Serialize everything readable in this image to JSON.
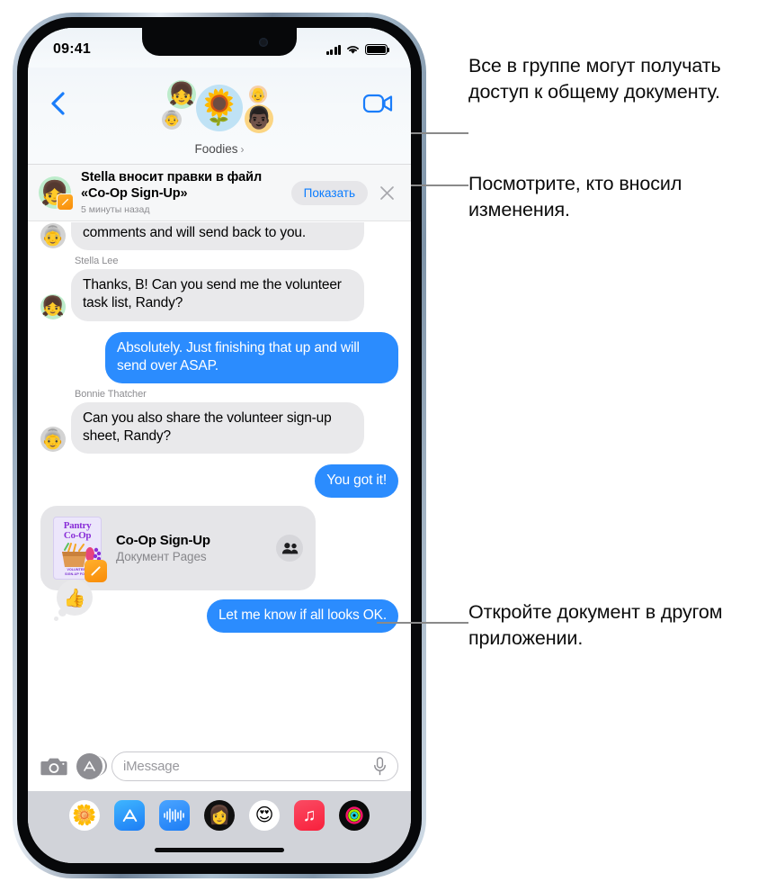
{
  "status_bar": {
    "time": "09:41",
    "signal_icon": "cellular-bars-icon",
    "wifi_icon": "wifi-icon",
    "battery_icon": "battery-icon"
  },
  "nav": {
    "back_icon": "chevron-left-icon",
    "video_icon": "facetime-video-icon",
    "group_name": "Foodies",
    "group_chevron": "›",
    "avatars": [
      {
        "name": "avatar-main-sunflower",
        "glyph": "🌻",
        "bg": "#bfe2f5"
      },
      {
        "name": "avatar-top-left-memoji",
        "glyph": "👧",
        "bg": "#bdeccb"
      },
      {
        "name": "avatar-bottom-left-memoji",
        "glyph": "👵",
        "bg": "#d3d3d3"
      },
      {
        "name": "avatar-top-right-memoji",
        "glyph": "👴",
        "bg": "#f6cfa8"
      },
      {
        "name": "avatar-bottom-right-memoji",
        "glyph": "👨🏿",
        "bg": "#fbd583"
      }
    ]
  },
  "collab_banner": {
    "avatar_glyph": "👧",
    "badge_icon": "pages-app-icon",
    "title": "Stella вносит правки в файл «Co-Op Sign-Up»",
    "subtitle": "5 минуты назад",
    "show_label": "Показать",
    "close_icon": "close-x-icon"
  },
  "messages": [
    {
      "id": "msg-bonnie-handbook",
      "direction": "in",
      "sender": "",
      "text": "Orientation Handbook, Meena! Adding comments and will send back to you.",
      "avatar_glyph": "👵",
      "avatar_bg": "#d3d3d3",
      "clipped": true
    },
    {
      "id": "msg-stella-tasklist",
      "direction": "in",
      "sender": "Stella Lee",
      "text": "Thanks, B! Can you send me the volunteer task list, Randy?",
      "avatar_glyph": "👧",
      "avatar_bg": "#bdeccb",
      "clipped": false
    },
    {
      "id": "msg-me-absolutely",
      "direction": "out",
      "sender": "",
      "text": "Absolutely. Just finishing that up and will send over ASAP.",
      "avatar_glyph": "",
      "avatar_bg": "",
      "clipped": false
    },
    {
      "id": "msg-bonnie-signup",
      "direction": "in",
      "sender": "Bonnie Thatcher",
      "text": "Can you also share the volunteer sign-up sheet, Randy?",
      "avatar_glyph": "👵",
      "avatar_bg": "#d3d3d3",
      "clipped": false
    },
    {
      "id": "msg-me-yougotit",
      "direction": "out",
      "sender": "",
      "text": "You got it!",
      "avatar_glyph": "",
      "avatar_bg": "",
      "clipped": false
    }
  ],
  "document_card": {
    "thumb_title_line1": "Pantry",
    "thumb_title_line2": "Co-Op",
    "thumb_footer_line1": "VOLUNTEER",
    "thumb_footer_line2": "SIGN-UP FORM",
    "badge_icon": "pages-app-icon",
    "name": "Co-Op Sign-Up",
    "kind": "Документ Pages",
    "collaborators_icon": "two-people-icon"
  },
  "last_message": {
    "id": "msg-me-looksok",
    "text": "Let me know if all looks OK.",
    "reaction_glyph": "👍",
    "reaction_name": "thumbs-up-reaction"
  },
  "input_bar": {
    "camera_icon": "camera-icon",
    "appstore_icon": "app-store-icon",
    "placeholder": "iMessage",
    "mic_icon": "microphone-icon"
  },
  "app_dock": [
    {
      "name": "dock-app-photos",
      "glyph": "🌼",
      "bg": "#ffffff"
    },
    {
      "name": "dock-app-store",
      "glyph": "🅰",
      "bg": "#1f9bff"
    },
    {
      "name": "dock-app-voice-memo",
      "glyph": "〰",
      "bg": "#2b8cfe"
    },
    {
      "name": "dock-app-memoji-1",
      "glyph": "👩",
      "bg": "#101010"
    },
    {
      "name": "dock-app-memoji-2",
      "glyph": "😍",
      "bg": "#ffffff"
    },
    {
      "name": "dock-app-music",
      "glyph": "♫",
      "bg": "#fa2d48"
    },
    {
      "name": "dock-app-fitness",
      "glyph": "◎",
      "bg": "#0a0a0a"
    }
  ],
  "callouts": [
    {
      "id": "callout-everyone-access",
      "text": "Все в группе могут получать доступ к общему документу."
    },
    {
      "id": "callout-see-who-changed",
      "text": "Посмотрите, кто вносил изменения."
    },
    {
      "id": "callout-open-in-other-app",
      "text": "Откройте документ в другом приложении."
    }
  ],
  "colors": {
    "accent_blue": "#2b8cfe",
    "link_blue": "#0a7cff",
    "bubble_grey": "#e9e9eb",
    "dock_bg": "#d1d3d9",
    "banner_bg": "#f6f7f8"
  }
}
